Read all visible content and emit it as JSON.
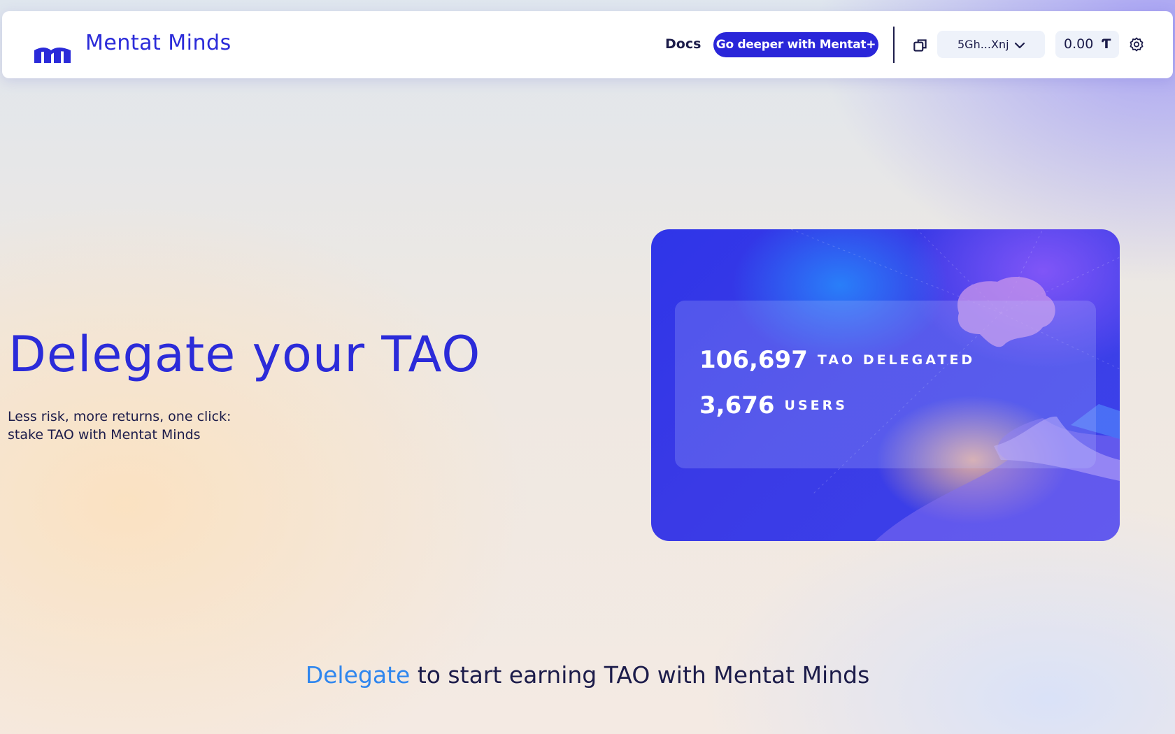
{
  "header": {
    "brand": "Mentat Minds",
    "docs_label": "Docs",
    "cta_label": "Go deeper with Mentat+",
    "wallet_address": "5Gh...Xnj",
    "balance": "0.00",
    "currency_symbol": "Ƭ"
  },
  "hero": {
    "title": "Delegate your TAO",
    "subtitle_line1": "Less risk, more returns, one click:",
    "subtitle_line2": "stake TAO with Mentat Minds"
  },
  "stats": {
    "delegated_value": "106,697",
    "delegated_label": "TAO DELEGATED",
    "users_value": "3,676",
    "users_label": "USERS"
  },
  "cta_section": {
    "accent": "Delegate",
    "rest": " to start earning TAO with Mentat Minds"
  },
  "colors": {
    "brand_blue": "#2b2bd9",
    "cta_bg": "#2a26d9",
    "accent_link": "#2f86ee",
    "text_dark": "#1c1c4a"
  },
  "icons": [
    "mentat-logo-icon",
    "copy-icon",
    "chevron-down-icon",
    "gear-icon"
  ]
}
